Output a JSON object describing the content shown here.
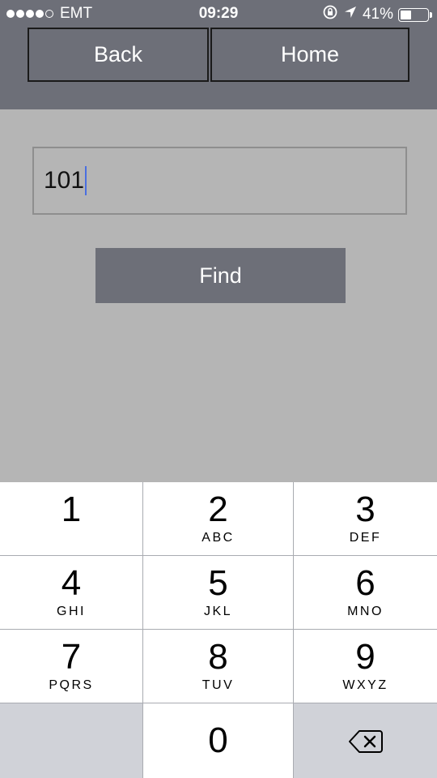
{
  "status_bar": {
    "carrier": "EMT",
    "time": "09:29",
    "battery": "41%",
    "battery_level": 0.41,
    "signal_bars": 4,
    "signal_max": 5
  },
  "nav": {
    "back_label": "Back",
    "home_label": "Home"
  },
  "entry": {
    "value": "101"
  },
  "find_label": "Find",
  "keypad": {
    "k1": {
      "num": "1",
      "letters": ""
    },
    "k2": {
      "num": "2",
      "letters": "ABC"
    },
    "k3": {
      "num": "3",
      "letters": "DEF"
    },
    "k4": {
      "num": "4",
      "letters": "GHI"
    },
    "k5": {
      "num": "5",
      "letters": "JKL"
    },
    "k6": {
      "num": "6",
      "letters": "MNO"
    },
    "k7": {
      "num": "7",
      "letters": "PQRS"
    },
    "k8": {
      "num": "8",
      "letters": "TUV"
    },
    "k9": {
      "num": "9",
      "letters": "WXYZ"
    },
    "k0": {
      "num": "0",
      "letters": ""
    }
  },
  "colors": {
    "header_bg": "#6d6f78",
    "body_bg": "#b5b5b5",
    "button_bg": "#6d6f78",
    "caret": "#4a6fe0",
    "key_gray": "#d0d2d8"
  }
}
